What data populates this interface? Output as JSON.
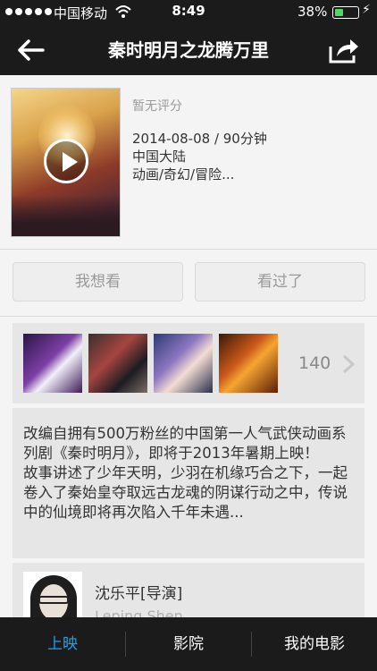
{
  "status_bar": {
    "carrier": "中国移动",
    "time": "8:49",
    "battery": "38%",
    "battery_level": 0.38,
    "signal_icon": "signal-dots-icon",
    "wifi_icon": "wifi-icon",
    "charging_icon": "bolt-icon"
  },
  "nav": {
    "title": "秦时明月之龙腾万里",
    "back_icon": "back-arrow-icon",
    "share_icon": "share-icon"
  },
  "movie": {
    "rating": "暂无评分",
    "date_duration": "2014-08-08 / 90分钟",
    "region": "中国大陆",
    "genre": "动画/奇幻/冒险..."
  },
  "actions": {
    "want_label": "我想看",
    "seen_label": "看过了"
  },
  "stills": {
    "count": "140"
  },
  "synopsis": {
    "para1": "改编自拥有500万粉丝的中国第一人气武侠动画系列剧《秦时明月》，即将于2013年暑期上映！",
    "para2": "故事讲述了少年天明，少羽在机缘巧合之下，一起卷入了秦始皇夺取远古龙魂的阴谋行动之中，传说中的仙境即将再次陷入千年未遇..."
  },
  "cast": {
    "name": "沈乐平[导演]",
    "name_en": "Leping Shen"
  },
  "tabs": [
    {
      "label": "上映"
    },
    {
      "label": "影院"
    },
    {
      "label": "我的电影"
    }
  ],
  "colors": {
    "accent": "#1fa3e8",
    "bar_bg": "#1b1b1b",
    "battery": "#4cd964"
  }
}
